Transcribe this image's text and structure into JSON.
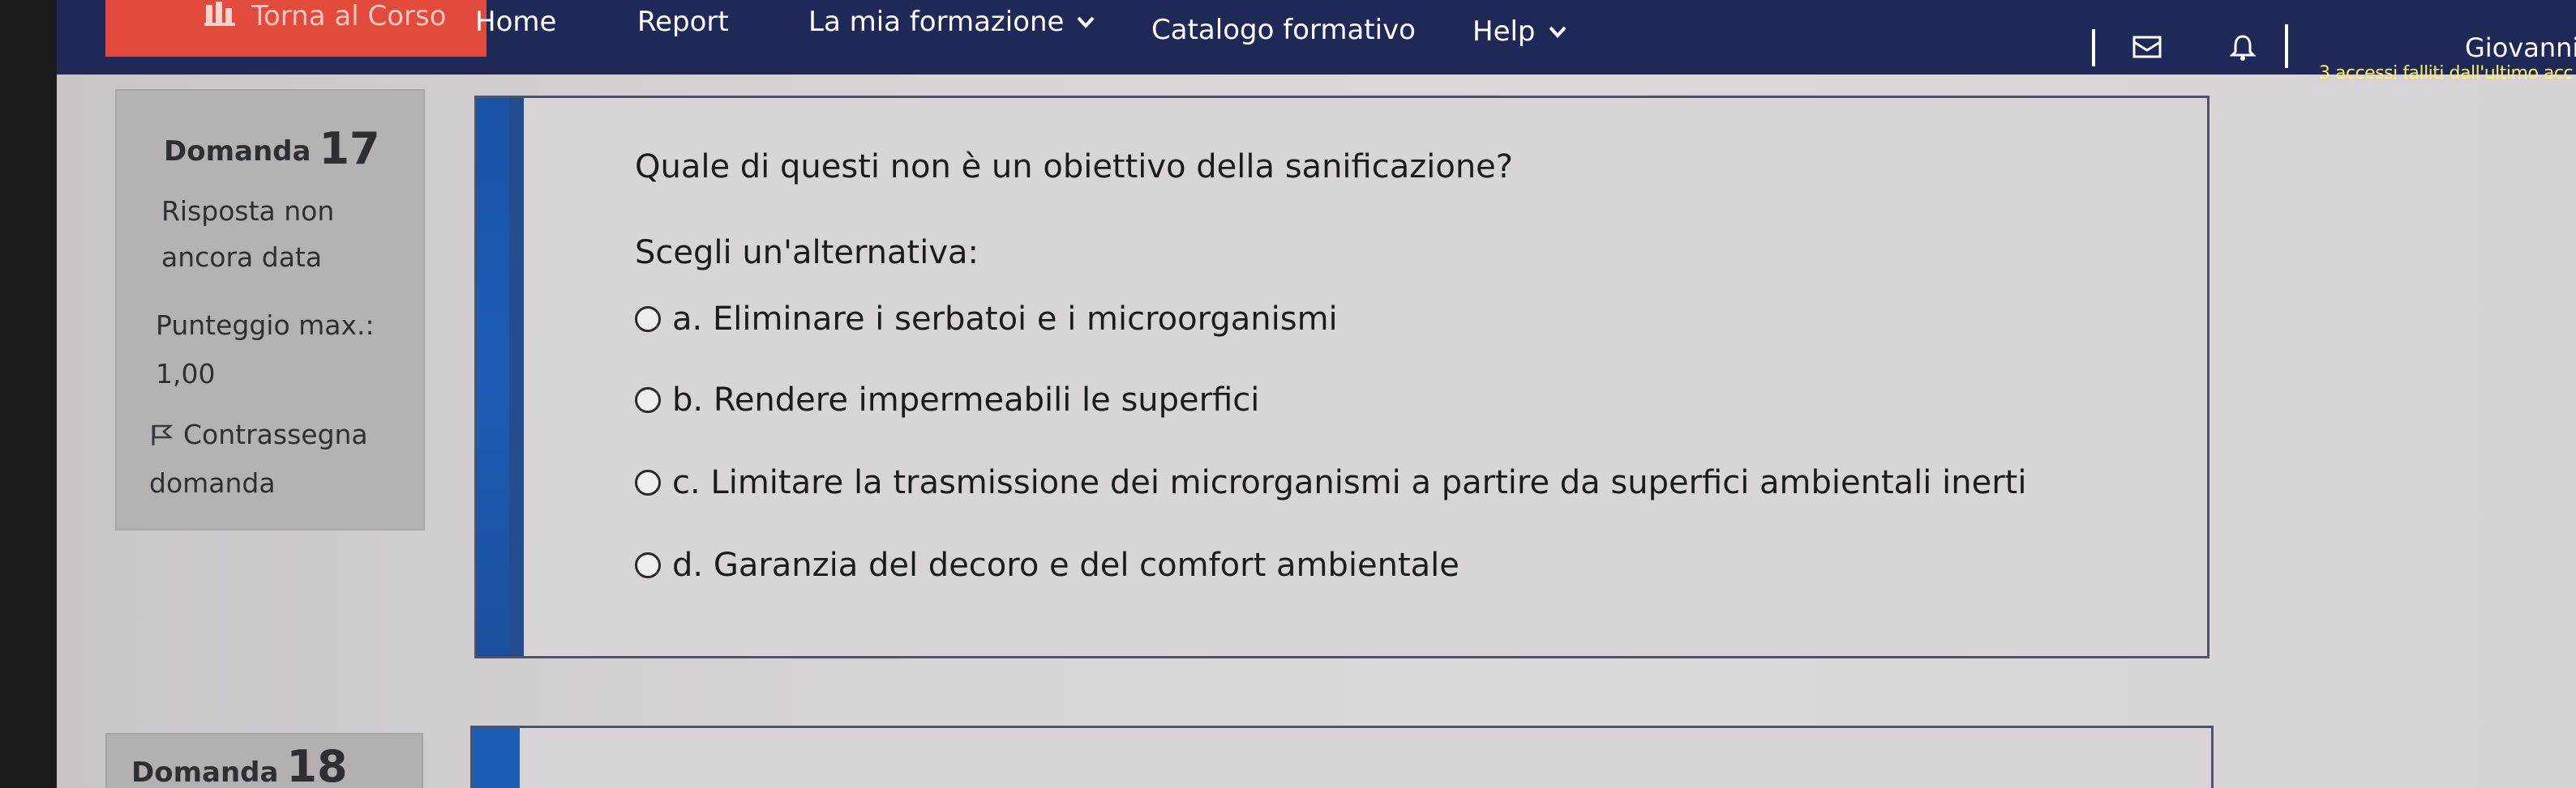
{
  "navbar": {
    "back_to_course": "Torna al Corso",
    "items": [
      {
        "label": "Home"
      },
      {
        "label": "Report"
      },
      {
        "label": "La mia formazione"
      },
      {
        "label": "Catalogo formativo"
      },
      {
        "label": "Help"
      }
    ],
    "user_name": "Giovanni",
    "login_info": "3 accessi falliti dall'ultimo acc"
  },
  "question": {
    "label": "Domanda",
    "number": "17",
    "state_line1": "Risposta non",
    "state_line2": "ancora data",
    "grade_label": "Punteggio max.:",
    "grade_value": "1,00",
    "flag_line1": "Contrassegna",
    "flag_line2": "domanda",
    "text": "Quale di questi non è un obiettivo della sanificazione?",
    "prompt": "Scegli un'alternativa:",
    "answers": [
      {
        "label": "a. Eliminare i serbatoi e i microorganismi"
      },
      {
        "label": "b. Rendere impermeabili le superfici"
      },
      {
        "label": "c. Limitare la trasmissione dei microrganismi a partire da superfici ambientali inerti"
      },
      {
        "label": "d. Garanzia del decoro e del comfort ambientale"
      }
    ]
  },
  "next_question": {
    "label": "Domanda",
    "number": "18"
  },
  "colors": {
    "navbar": "#1e2957",
    "back_button": "#e24a3b",
    "accent": "#1c5db5",
    "login_info": "#ffee66"
  }
}
